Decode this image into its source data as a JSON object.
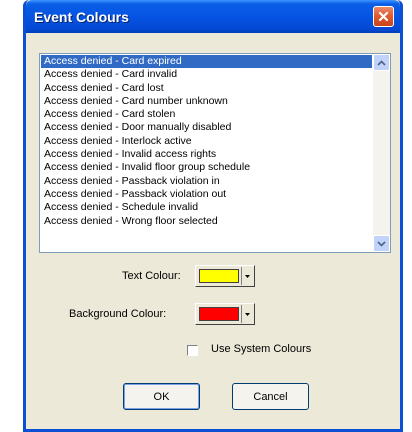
{
  "window": {
    "title": "Event Colours"
  },
  "event_list": {
    "items": [
      "Access denied - Card expired",
      "Access denied - Card invalid",
      "Access denied - Card lost",
      "Access denied - Card number unknown",
      "Access denied - Card stolen",
      "Access denied - Door manually disabled",
      "Access denied - Interlock active",
      "Access denied - Invalid access rights",
      "Access denied - Invalid floor group schedule",
      "Access denied - Passback violation in",
      "Access denied - Passback violation out",
      "Access denied - Schedule invalid",
      "Access denied - Wrong floor selected"
    ],
    "selected_index": 0
  },
  "text_colour": {
    "label": "Text Colour:",
    "value": "#ffff00"
  },
  "background_colour": {
    "label": "Background Colour:",
    "value": "#ff0000"
  },
  "use_system_colours": {
    "label": "Use System Colours",
    "checked": false
  },
  "buttons": {
    "ok_label": "OK",
    "cancel_label": "Cancel"
  },
  "icons": {
    "close": "close-icon",
    "scroll_up": "chevron-up-icon",
    "scroll_down": "chevron-down-icon",
    "dropdown": "dropdown-arrow-icon"
  }
}
